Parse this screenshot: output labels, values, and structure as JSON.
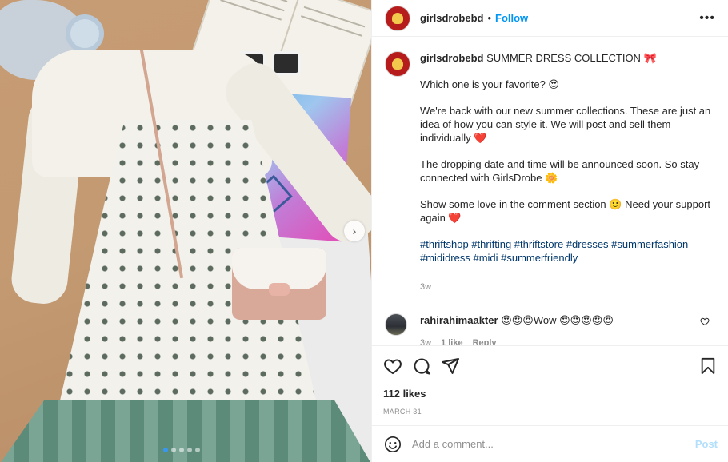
{
  "post": {
    "username": "girlsdrobebd",
    "separator": "•",
    "follow_label": "Follow",
    "more_label": "•••",
    "image_count": 5,
    "active_image_index": 0
  },
  "caption": {
    "username": "girlsdrobebd",
    "title": "SUMMER DRESS COLLECTION 🎀",
    "line1": "Which one is your favorite? 😍",
    "line2_text": "We're back with our new summer collections. These are just an idea of how you can style it. We will post and sell them individually ",
    "line2_emoji": "❤️",
    "line3": "The dropping date and time will be announced soon. So stay connected with GirlsDrobe 🌼",
    "line4_text": "Show some love in the comment section 🙂 Need your support again ",
    "line4_emoji": "❤️",
    "hashtags": "#thriftshop #thrifting #thriftstore #dresses #summerfashion #mididress #midi #summerfriendly",
    "age": "3w"
  },
  "comment": {
    "username": "rahirahimaakter",
    "text": "😍😍😍Wow 😍😍😍😍😍",
    "age": "3w",
    "likes": "1 like",
    "reply_label": "Reply"
  },
  "stats": {
    "likes": "112 likes",
    "date": "MARCH 31"
  },
  "composer": {
    "placeholder": "Add a comment...",
    "post_label": "Post"
  },
  "icons": {
    "like": "heart-icon",
    "comment": "comment-icon",
    "share": "share-icon",
    "save": "bookmark-icon",
    "emoji": "smiley-icon",
    "next": "chevron-right-icon"
  },
  "colors": {
    "follow": "#0095f6",
    "hashtag": "#00376b",
    "muted": "#8e8e8e",
    "post_disabled": "#b2dffc",
    "avatar_brand": "#b71c1c"
  }
}
